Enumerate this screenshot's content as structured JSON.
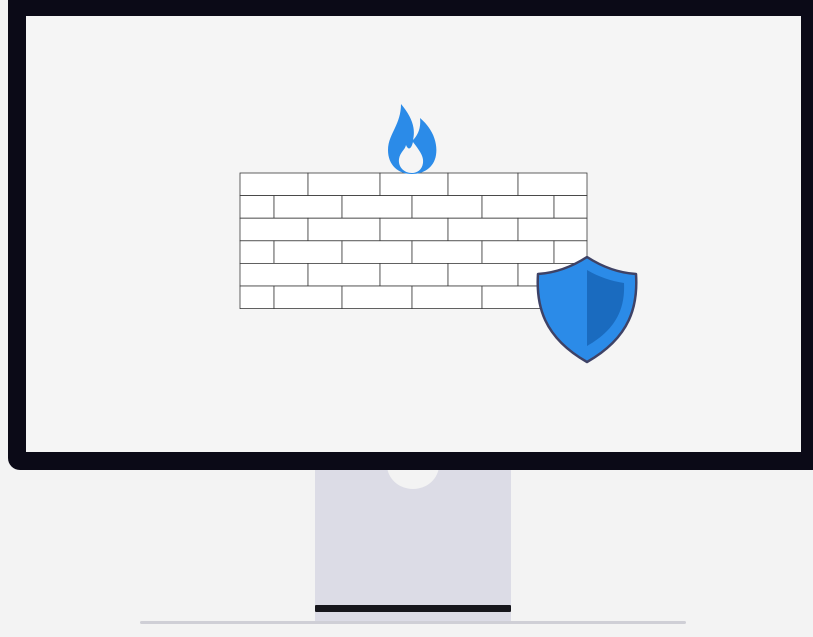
{
  "illustration": {
    "subject": "firewall-monitor",
    "icons": [
      "monitor-icon",
      "brick-wall-icon",
      "fire-icon",
      "shield-icon"
    ]
  },
  "colors": {
    "page_bg": "#f3f3f3",
    "screen_bg": "#f5f5f5",
    "bezel": "#0b0a17",
    "stand": "#dcdce6",
    "stand_base": "#16161c",
    "brick_fill": "#ffffff",
    "brick_stroke": "#3a3a3a",
    "accent_blue": "#2b8be8",
    "accent_blue_dark": "#1a6bbf",
    "shield_outline": "#3e4266",
    "ground_line": "#cfcfd6"
  }
}
